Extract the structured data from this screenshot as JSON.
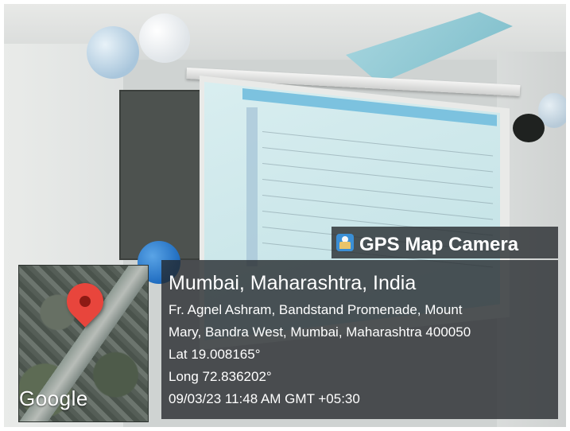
{
  "overlay": {
    "app_name": "GPS Map Camera",
    "app_icon": "gps-map-camera-icon",
    "place": "Mumbai, Maharashtra, India",
    "address_line1": "Fr. Agnel Ashram, Bandstand Promenade, Mount",
    "address_line2": "Mary, Bandra West, Mumbai, Maharashtra 400050",
    "latitude": "Lat 19.008165°",
    "longitude": "Long 72.836202°",
    "datetime": "09/03/23 11:48 AM GMT +05:30"
  },
  "map": {
    "attribution": "Google",
    "marker_icon": "location-pin-icon"
  }
}
